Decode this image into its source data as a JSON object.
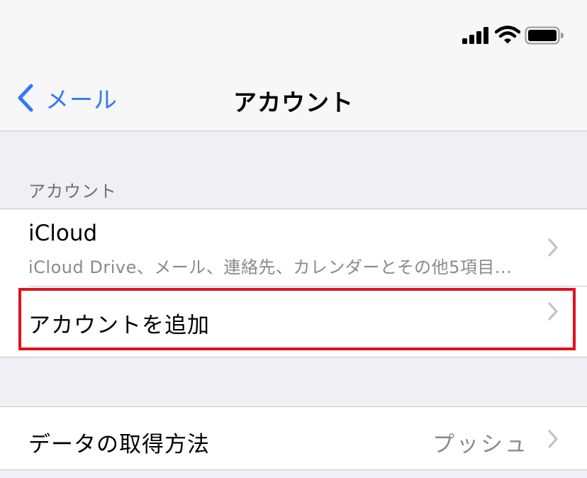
{
  "status_bar": {
    "icons": [
      "cellular-signal-icon",
      "wifi-icon",
      "battery-icon"
    ]
  },
  "nav": {
    "back_label": "メール",
    "title": "アカウント"
  },
  "accounts_section": {
    "header": "アカウント",
    "items": [
      {
        "title": "iCloud",
        "subtitle": "iCloud Drive、メール、連絡先、カレンダーとその他5項目..."
      }
    ],
    "add_account_label": "アカウントを追加"
  },
  "fetch_section": {
    "label": "データの取得方法",
    "value": "プッシュ"
  },
  "colors": {
    "accent": "#3478f6",
    "highlight": "#e0121e",
    "secondary_text": "#8a8a8e",
    "background": "#efeff4"
  }
}
